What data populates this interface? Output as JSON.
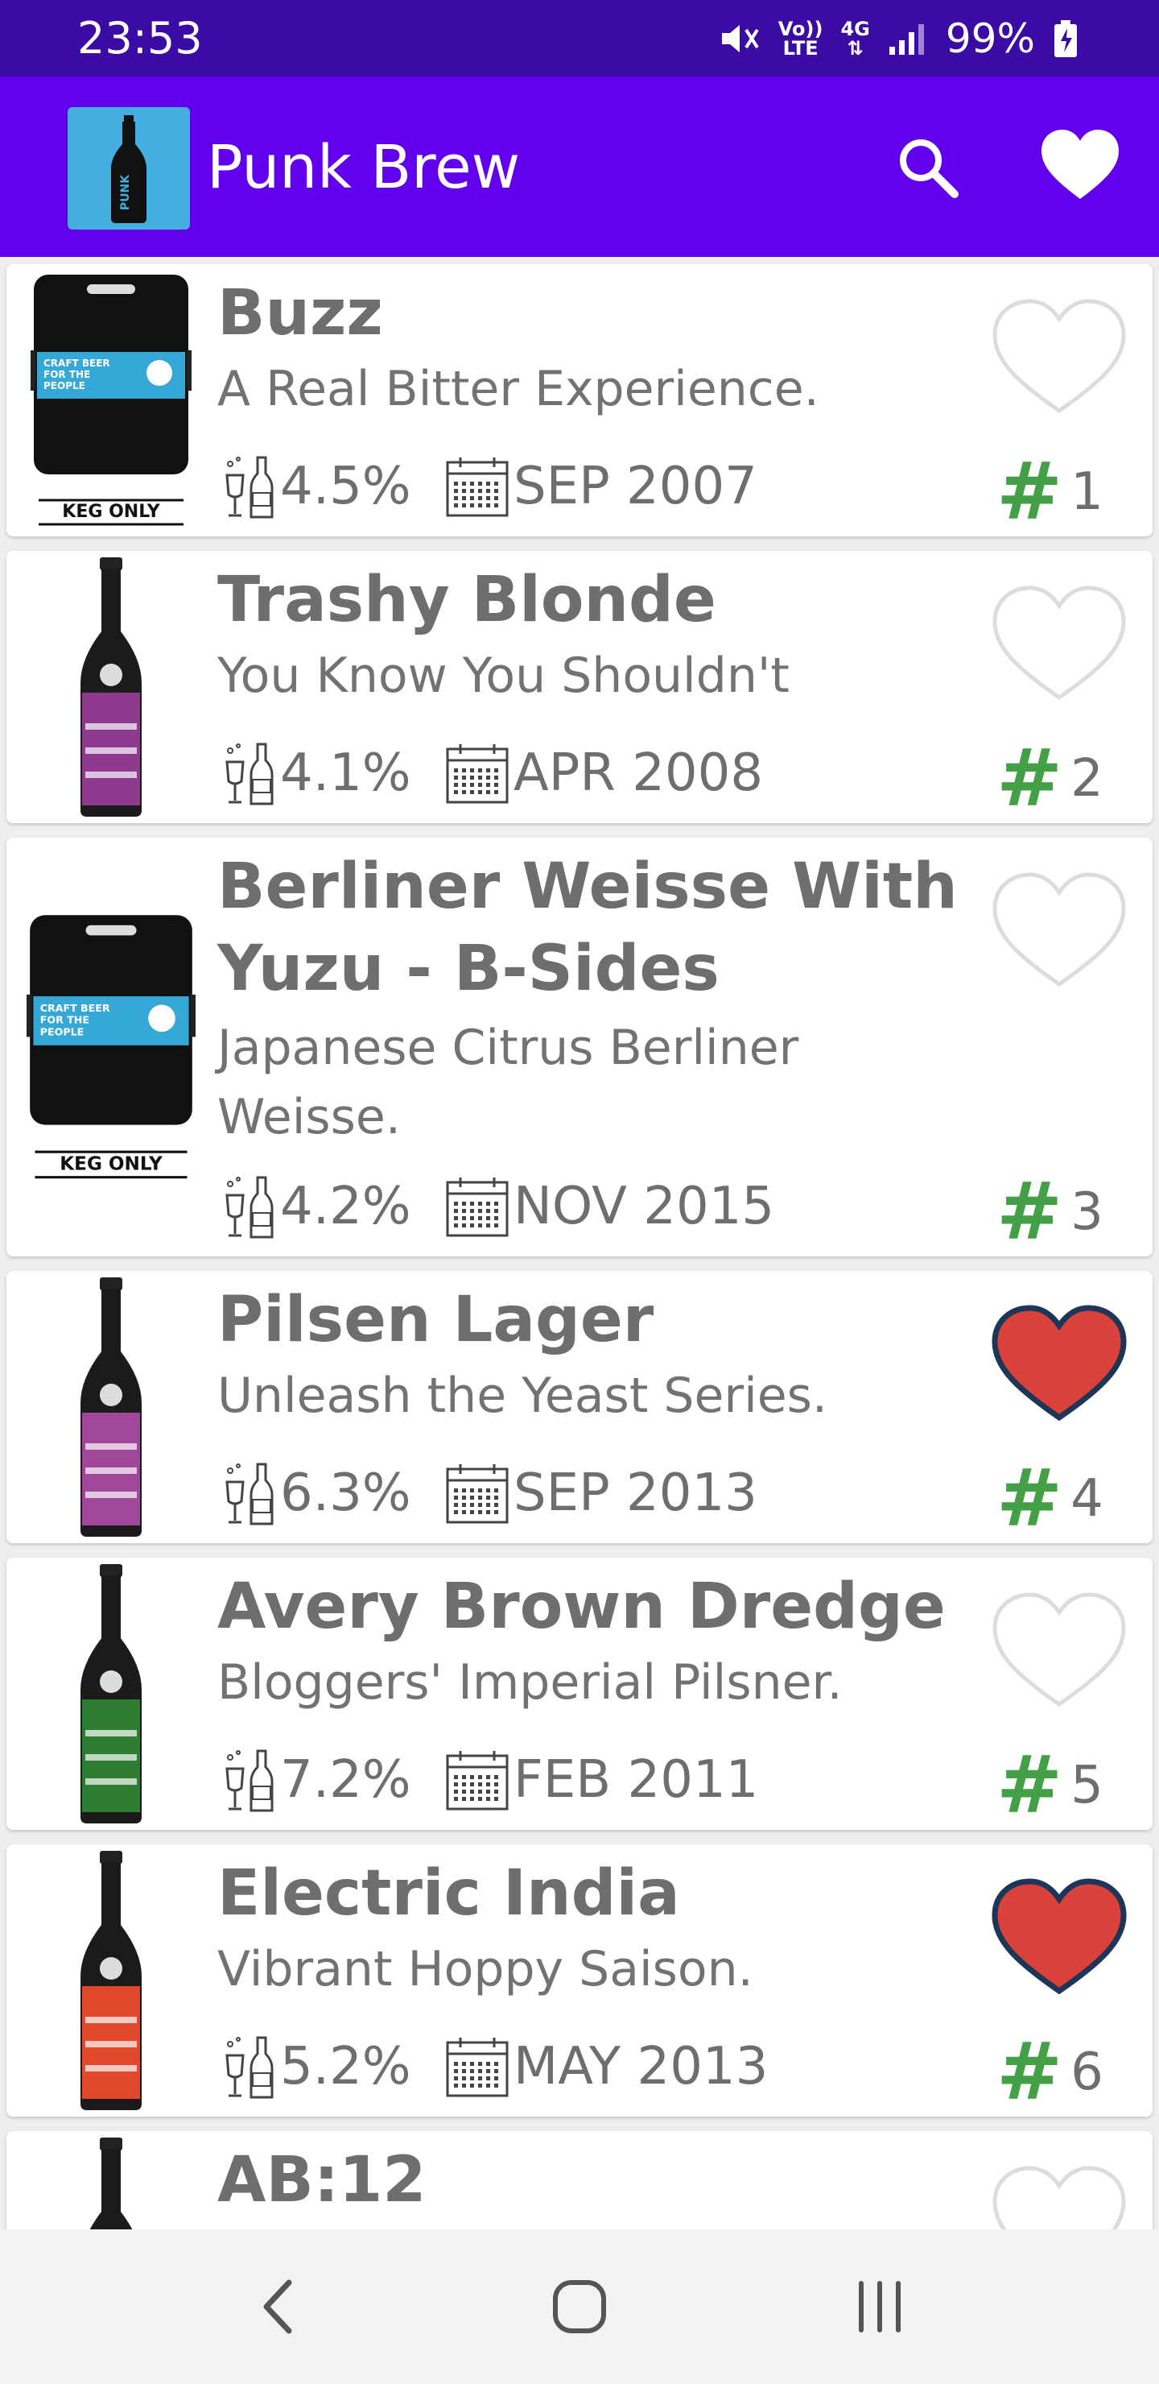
{
  "status_bar": {
    "time": "23:53",
    "signal_top": "Vo))",
    "signal_bottom": "LTE",
    "network": "4G",
    "battery": "99%"
  },
  "app_bar": {
    "title": "Punk Brew",
    "logo_text": "PUNK"
  },
  "beers": [
    {
      "name": "Buzz",
      "tagline": "A Real Bitter Experience.",
      "abv": "4.5%",
      "date": "SEP 2007",
      "rank": "1",
      "favorite": false,
      "image": "keg",
      "label_text": "CRAFT BEER FOR THE PEOPLE",
      "badge": "KEG ONLY"
    },
    {
      "name": "Trashy Blonde",
      "tagline": "You Know You Shouldn't",
      "abv": "4.1%",
      "date": "APR 2008",
      "rank": "2",
      "favorite": false,
      "image": "bottle",
      "label_color": "#8e3b8f"
    },
    {
      "name": "Berliner Weisse With Yuzu - B-Sides",
      "tagline": "Japanese Citrus Berliner Weisse.",
      "abv": "4.2%",
      "date": "NOV 2015",
      "rank": "3",
      "favorite": false,
      "image": "keg",
      "label_text": "CRAFT BEER FOR THE PEOPLE",
      "badge": "KEG ONLY"
    },
    {
      "name": "Pilsen Lager",
      "tagline": "Unleash the Yeast Series.",
      "abv": "6.3%",
      "date": "SEP 2013",
      "rank": "4",
      "favorite": true,
      "image": "bottle",
      "label_color": "#a0479b"
    },
    {
      "name": "Avery Brown Dredge",
      "tagline": "Bloggers' Imperial Pilsner.",
      "abv": "7.2%",
      "date": "FEB 2011",
      "rank": "5",
      "favorite": false,
      "image": "bottle",
      "label_color": "#2e7d32"
    },
    {
      "name": "Electric India",
      "tagline": "Vibrant Hoppy Saison.",
      "abv": "5.2%",
      "date": "MAY 2013",
      "rank": "6",
      "favorite": true,
      "image": "bottle",
      "label_color": "#e2492a"
    },
    {
      "name": "AB:12",
      "tagline": "",
      "abv": "",
      "date": "",
      "rank": "",
      "favorite": false,
      "image": "bottle",
      "label_color": "#222222"
    }
  ],
  "colors": {
    "status_bar": "#3a0ca3",
    "app_bar": "#6200ee",
    "heart_filled": "#d9413a",
    "heart_outline": "#1d3557",
    "heart_empty": "#dcdcdc",
    "rank_hash": "#43a047",
    "text_gray": "#6e6e6e"
  },
  "icons": {
    "search": "search-icon",
    "favorites": "heart-icon",
    "abv": "glass-bottle-icon",
    "date": "calendar-icon",
    "back": "back-icon",
    "home": "home-icon",
    "recents": "recents-icon"
  }
}
